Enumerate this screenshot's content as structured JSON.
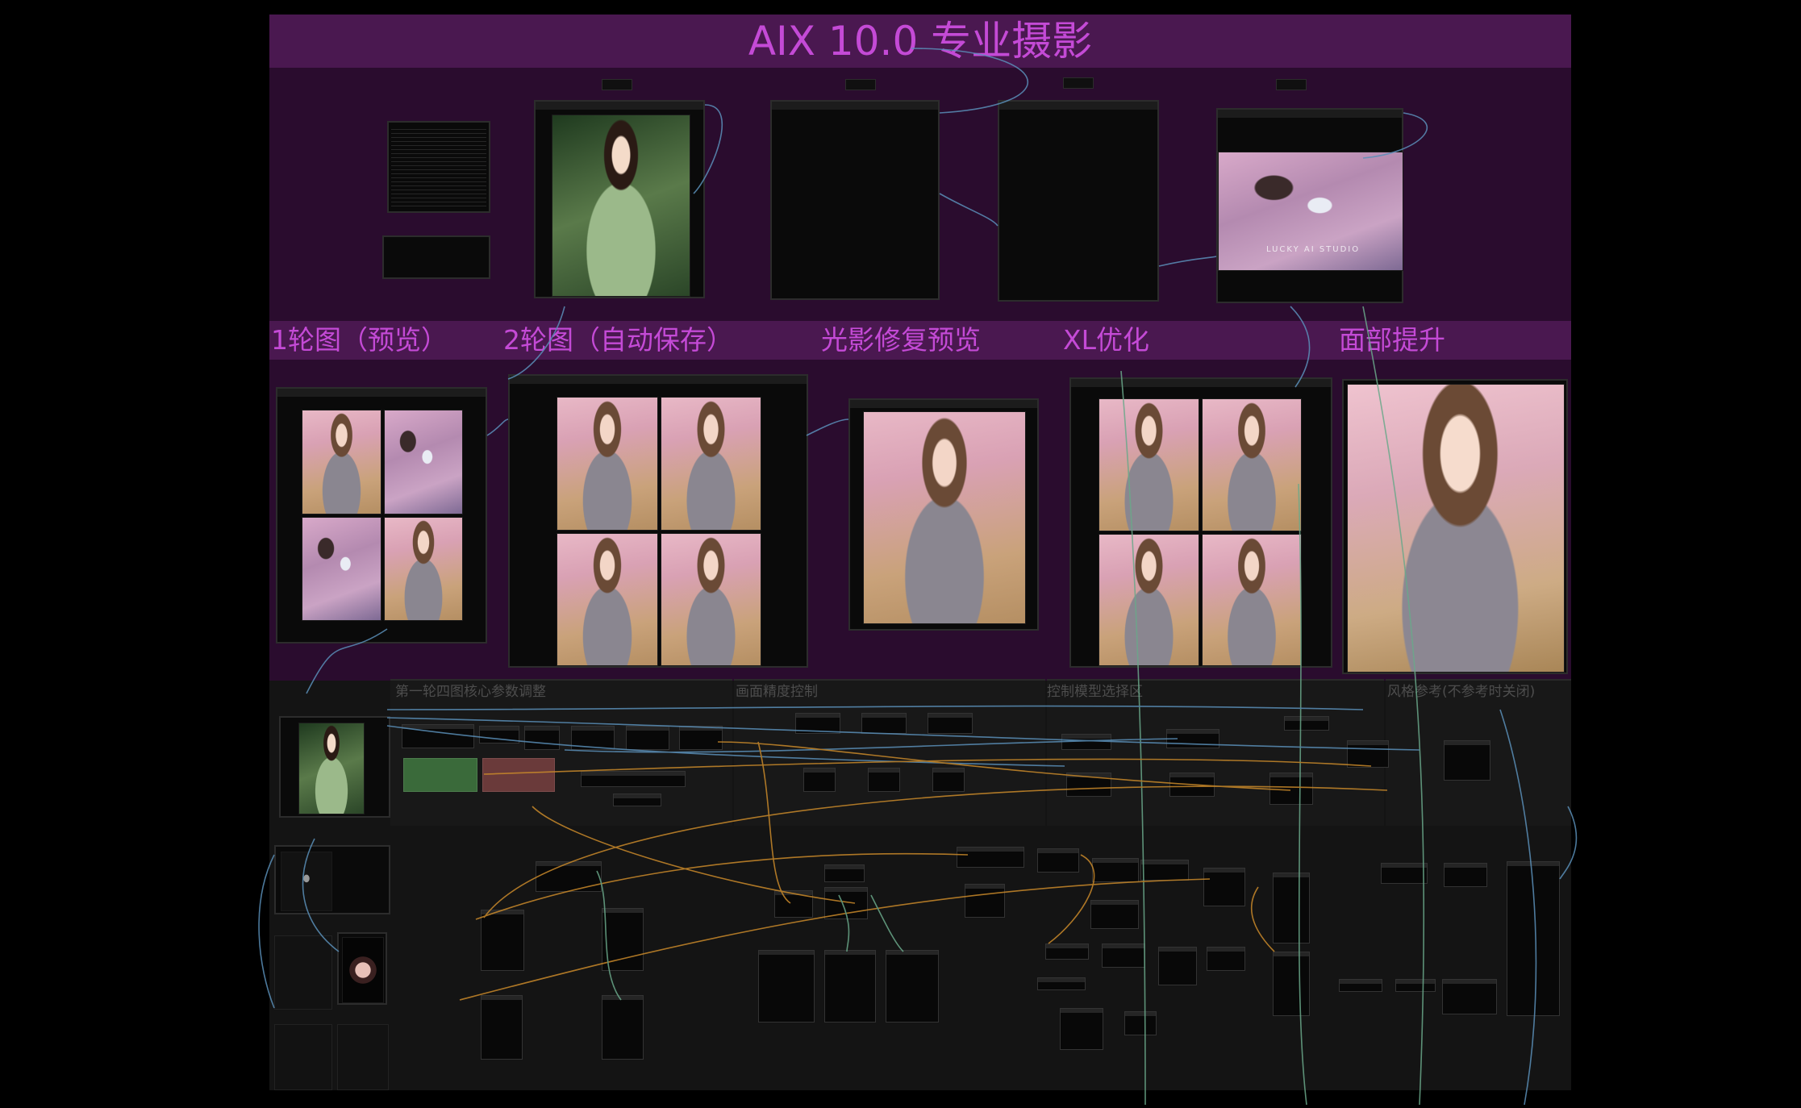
{
  "app_title": "AIX 10.0 专业摄影",
  "sections": [
    {
      "id": "round1",
      "label": "1轮图（预览）"
    },
    {
      "id": "round2",
      "label": "2轮图（自动保存）"
    },
    {
      "id": "lighting",
      "label": "光影修复预览"
    },
    {
      "id": "xl",
      "label": "XL优化"
    },
    {
      "id": "face",
      "label": "面部提升"
    }
  ],
  "workspace_groups": [
    {
      "id": "core",
      "label": "第一轮四图核心参数调整"
    },
    {
      "id": "precision",
      "label": "画面精度控制"
    },
    {
      "id": "model",
      "label": "控制模型选择区"
    },
    {
      "id": "style",
      "label": "风格参考(不参考时关闭)"
    }
  ],
  "watermark_text": "LUCKY AI STUDIO",
  "colors": {
    "group_bg": "#2a0c2e",
    "title_bar": "#4a1850",
    "accent_text": "#c44ad6",
    "canvas_bg": "#000000",
    "workspace_bg": "#141414",
    "wire_blue": "#5a8fb8",
    "wire_orange": "#c9892a",
    "wire_green": "#6aa88a",
    "node_green": "#3a6a3a",
    "node_red": "#6a3a3a"
  }
}
